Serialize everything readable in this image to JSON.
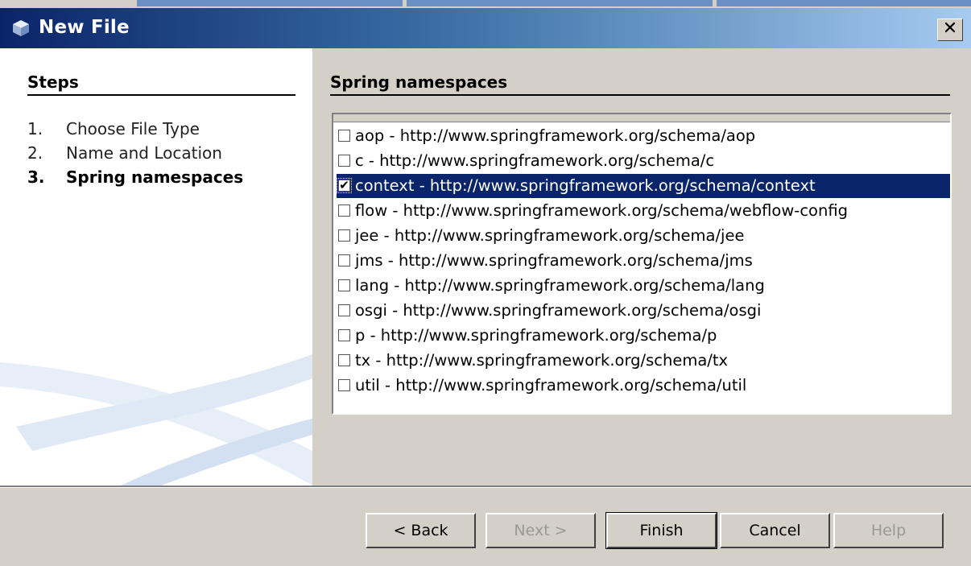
{
  "window": {
    "title": "New File",
    "close_label": "✕"
  },
  "steps": {
    "header": "Steps",
    "items": [
      {
        "num": "1.",
        "label": "Choose File Type",
        "current": false
      },
      {
        "num": "2.",
        "label": "Name and Location",
        "current": false
      },
      {
        "num": "3.",
        "label": "Spring namespaces",
        "current": true
      }
    ]
  },
  "namespaces": {
    "header": "Spring namespaces",
    "items": [
      {
        "label": "aop - http://www.springframework.org/schema/aop",
        "checked": false,
        "selected": false
      },
      {
        "label": "c - http://www.springframework.org/schema/c",
        "checked": false,
        "selected": false
      },
      {
        "label": "context - http://www.springframework.org/schema/context",
        "checked": true,
        "selected": true
      },
      {
        "label": "flow - http://www.springframework.org/schema/webflow-config",
        "checked": false,
        "selected": false
      },
      {
        "label": "jee - http://www.springframework.org/schema/jee",
        "checked": false,
        "selected": false
      },
      {
        "label": "jms - http://www.springframework.org/schema/jms",
        "checked": false,
        "selected": false
      },
      {
        "label": "lang - http://www.springframework.org/schema/lang",
        "checked": false,
        "selected": false
      },
      {
        "label": "osgi - http://www.springframework.org/schema/osgi",
        "checked": false,
        "selected": false
      },
      {
        "label": "p - http://www.springframework.org/schema/p",
        "checked": false,
        "selected": false
      },
      {
        "label": "tx - http://www.springframework.org/schema/tx",
        "checked": false,
        "selected": false
      },
      {
        "label": "util - http://www.springframework.org/schema/util",
        "checked": false,
        "selected": false
      }
    ]
  },
  "buttons": {
    "back": "< Back",
    "next": "Next >",
    "finish": "Finish",
    "cancel": "Cancel",
    "help": "Help"
  },
  "colors": {
    "title_start": "#0a246a",
    "title_end": "#a6caf0",
    "selection": "#0a246a",
    "dialog_bg": "#d4d0c8"
  },
  "icons": {
    "title": "netbeans-cube-icon",
    "close": "close-icon",
    "checkbox_checked": "checkmark-icon"
  }
}
